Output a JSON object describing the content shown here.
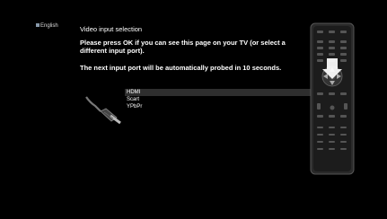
{
  "language": {
    "label": "English"
  },
  "title": "Video input selection",
  "message": {
    "line1": "Please press OK if you can see this page on your TV (or select a different input port).",
    "line2": "The next input port will be automatically probed in 10 seconds."
  },
  "options": [
    {
      "label": "HDMI",
      "selected": true
    },
    {
      "label": "Scart",
      "selected": false
    },
    {
      "label": "YPbPr",
      "selected": false
    }
  ],
  "colors": {
    "background": "#000000",
    "selection": "#2e2e2e",
    "text": "#ffffff"
  },
  "icons": {
    "connector": "hdmi-cable-icon",
    "remote": "remote-control-icon"
  }
}
